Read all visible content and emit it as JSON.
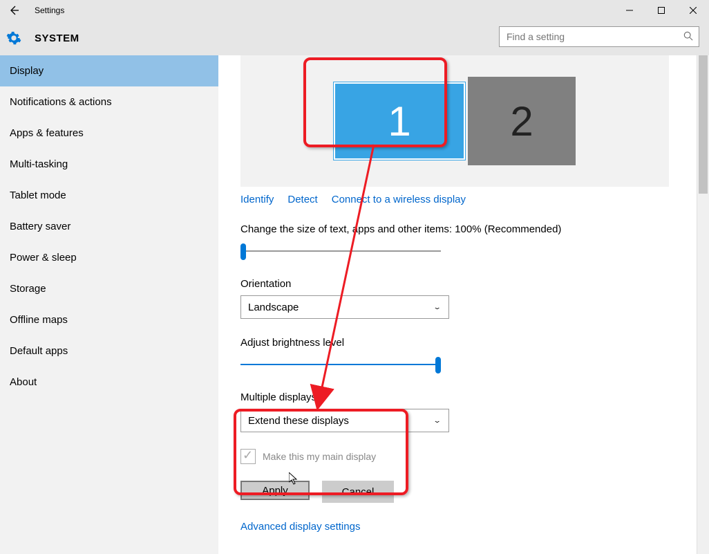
{
  "window": {
    "title": "Settings"
  },
  "header": {
    "system": "SYSTEM",
    "search_placeholder": "Find a setting"
  },
  "sidebar": {
    "items": [
      "Display",
      "Notifications & actions",
      "Apps & features",
      "Multi-tasking",
      "Tablet mode",
      "Battery saver",
      "Power & sleep",
      "Storage",
      "Offline maps",
      "Default apps",
      "About"
    ],
    "active_index": 0
  },
  "monitors": {
    "primary": "1",
    "secondary": "2"
  },
  "links": {
    "identify": "Identify",
    "detect": "Detect",
    "wireless": "Connect to a wireless display"
  },
  "scale": {
    "label": "Change the size of text, apps and other items: 100% (Recommended)",
    "value_pct": 0
  },
  "orientation": {
    "label": "Orientation",
    "value": "Landscape"
  },
  "brightness": {
    "label": "Adjust brightness level",
    "value_pct": 100
  },
  "multi": {
    "label": "Multiple displays",
    "value": "Extend these displays"
  },
  "maindisplay": {
    "label": "Make this my main display"
  },
  "buttons": {
    "apply": "Apply",
    "cancel": "Cancel"
  },
  "advanced": "Advanced display settings"
}
